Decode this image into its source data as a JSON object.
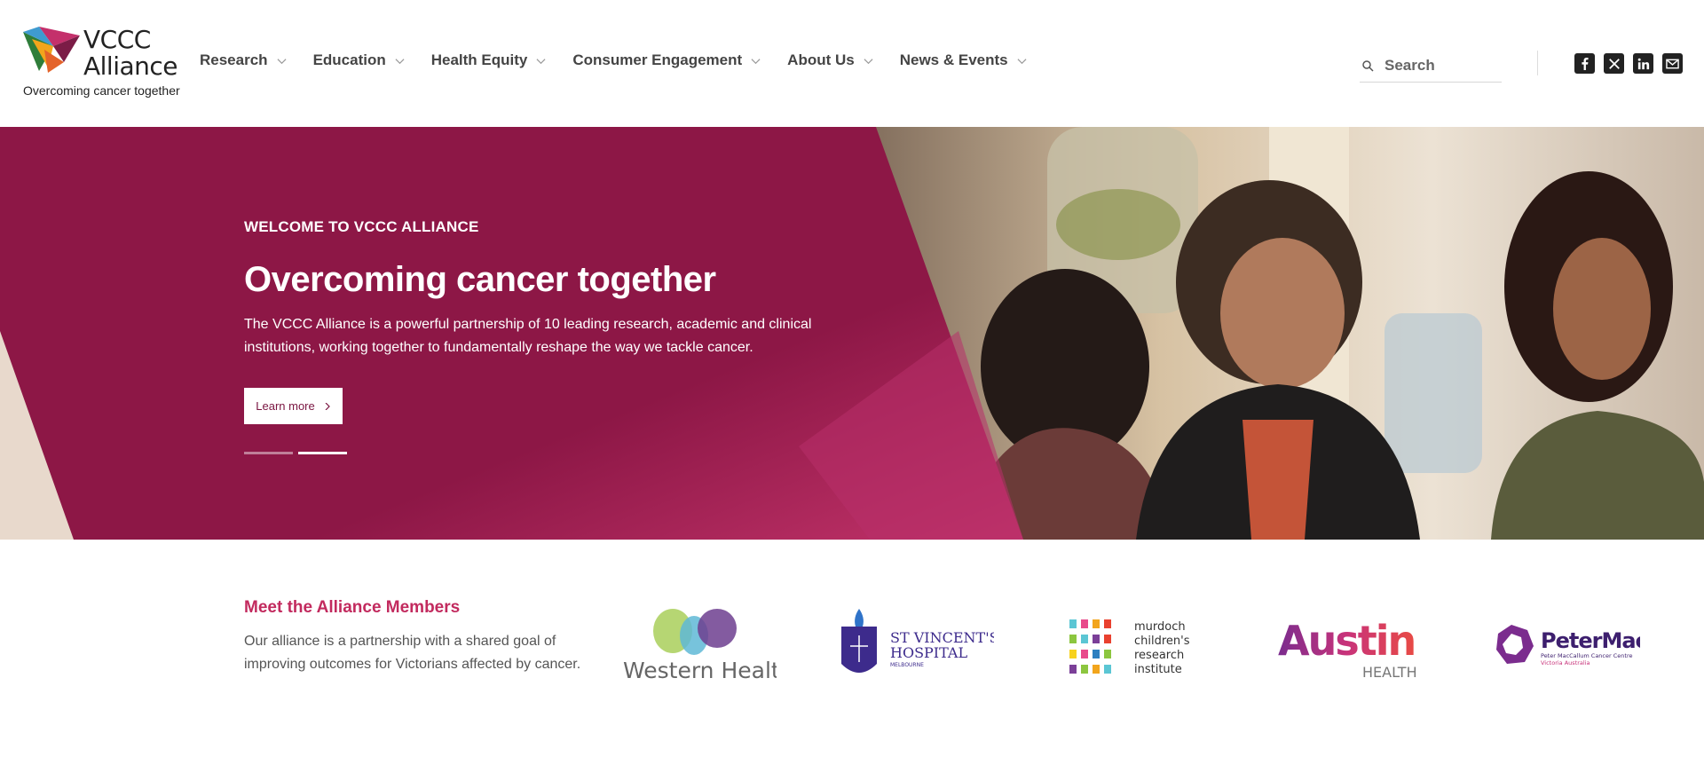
{
  "header": {
    "logo": {
      "line1": "VCCC",
      "line2": "Alliance",
      "tagline": "Overcoming cancer together"
    },
    "nav": [
      {
        "label": "Research"
      },
      {
        "label": "Education"
      },
      {
        "label": "Health Equity"
      },
      {
        "label": "Consumer Engagement"
      },
      {
        "label": "About Us"
      },
      {
        "label": "News & Events"
      }
    ],
    "search": {
      "placeholder": "Search",
      "value": ""
    },
    "social": [
      "facebook-icon",
      "x-icon",
      "linkedin-icon",
      "email-icon"
    ]
  },
  "hero": {
    "eyebrow": "WELCOME TO VCCC ALLIANCE",
    "title": "Overcoming cancer together",
    "description": "The VCCC Alliance is a powerful partnership of 10 leading research, academic and clinical institutions, working together to fundamentally reshape the way we tackle cancer.",
    "cta": "Learn more",
    "slides_total": 2,
    "active_slide": 2
  },
  "members": {
    "title": "Meet the Alliance Members",
    "description": "Our alliance is a partnership with a shared goal of improving outcomes for Victorians affected by cancer.",
    "logos": {
      "western": "Western Health",
      "stvincents_line1": "ST VINCENT'S",
      "stvincents_line2": "HOSPITAL",
      "stvincents_line3": "MELBOURNE",
      "mcri_line1": "murdoch",
      "mcri_line2": "children's",
      "mcri_line3": "research",
      "mcri_line4": "institute",
      "austin_line1": "Austin",
      "austin_line2": "HEALTH",
      "petermac_line1": "PeterMac",
      "petermac_line2": "Peter MacCallum Cancer Centre",
      "petermac_line3": "Victoria Australia"
    }
  },
  "colors": {
    "brand": "#8b1746",
    "accent": "#c22a5e",
    "text": "#444444"
  }
}
